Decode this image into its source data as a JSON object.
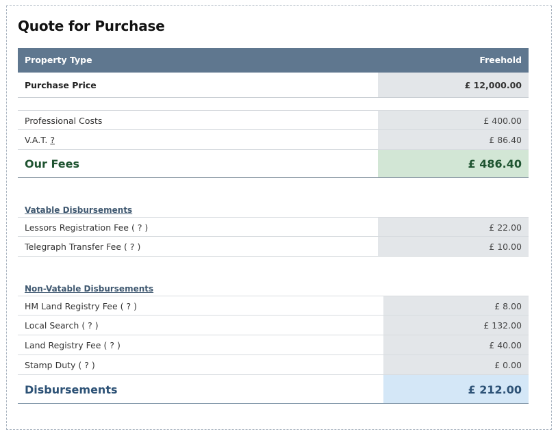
{
  "title": "Quote for Purchase",
  "header": {
    "label": "Property Type",
    "value": "Freehold"
  },
  "purchase_price": {
    "label": "Purchase Price",
    "value": "£ 12,000.00"
  },
  "fees": [
    {
      "label": "Professional Costs",
      "help": "",
      "value": "£ 400.00"
    },
    {
      "label": "V.A.T.",
      "help": "?",
      "value": "£ 86.40"
    }
  ],
  "our_fees": {
    "label": "Our Fees",
    "value": "£ 486.40"
  },
  "vatable": {
    "heading": "Vatable Disbursements",
    "items": [
      {
        "label": "Lessors Registration Fee",
        "help": "( ? )",
        "value": "£ 22.00"
      },
      {
        "label": "Telegraph Transfer Fee",
        "help": "( ? )",
        "value": "£ 10.00"
      }
    ]
  },
  "non_vatable": {
    "heading": "Non-Vatable Disbursements",
    "items": [
      {
        "label": "HM Land Registry Fee",
        "help": "( ? )",
        "value": "£ 8.00"
      },
      {
        "label": "Local Search",
        "help": "( ? )",
        "value": "£ 132.00"
      },
      {
        "label": "Land Registry Fee",
        "help": "( ? )",
        "value": "£ 40.00"
      },
      {
        "label": "Stamp Duty",
        "help": "( ? )",
        "value": "£ 0.00"
      }
    ]
  },
  "disbursements_total": {
    "label": "Disbursements",
    "value": "£ 212.00"
  }
}
